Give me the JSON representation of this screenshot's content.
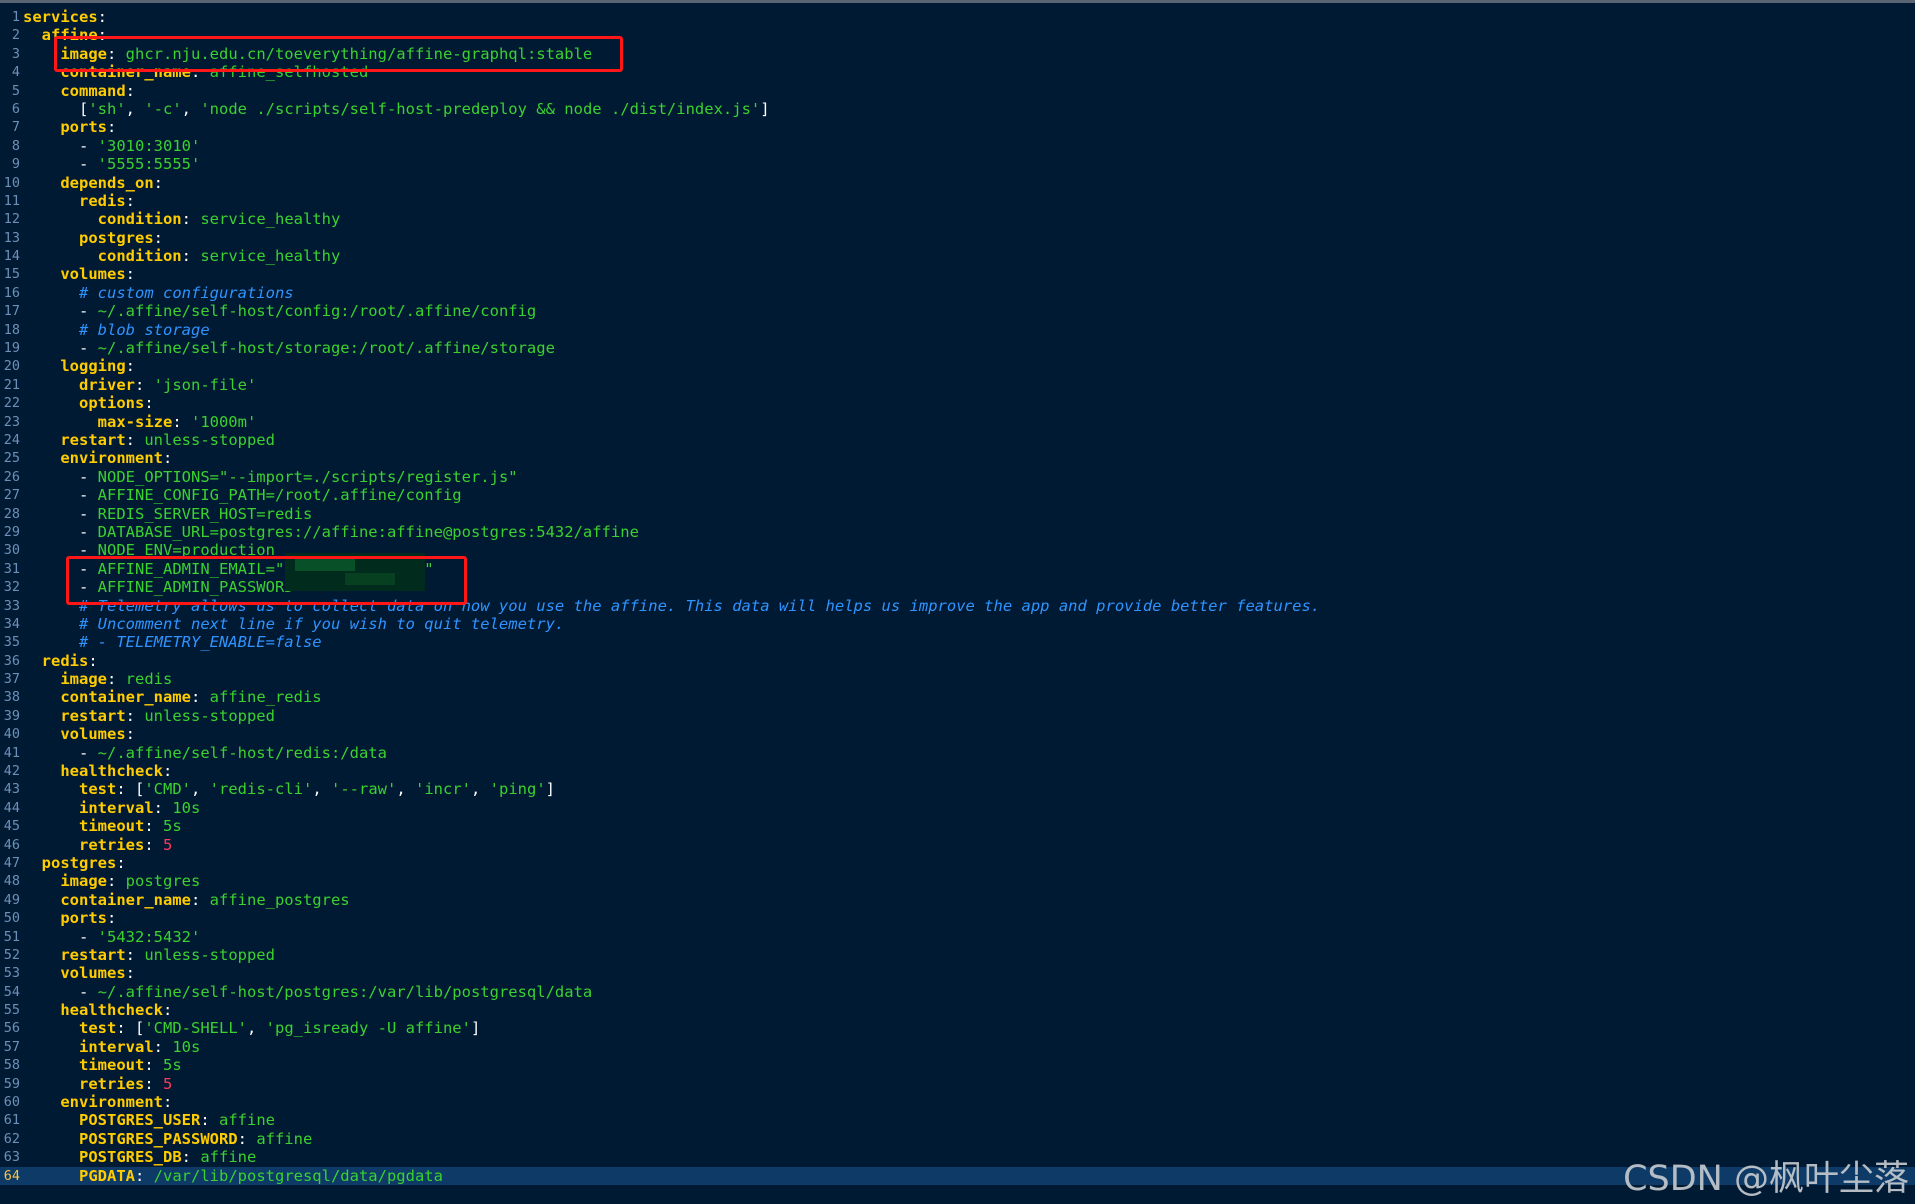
{
  "editor": {
    "language": "yaml",
    "current_line": 64,
    "colors": {
      "background": "#011a33",
      "key": "#ffcc00",
      "string": "#3bd12f",
      "number": "#ff3b5c",
      "comment": "#2f94ff",
      "line_number": "#6d90b8",
      "current_line_bg": "#0d3a66",
      "highlight_box": "#ff1616"
    },
    "lines": [
      [
        {
          "s": "k",
          "t": "services"
        },
        {
          "s": "p",
          "t": ":"
        }
      ],
      [
        {
          "s": "t",
          "t": "  "
        },
        {
          "s": "k",
          "t": "affine"
        },
        {
          "s": "p",
          "t": ":"
        }
      ],
      [
        {
          "s": "t",
          "t": "    "
        },
        {
          "s": "k",
          "t": "image"
        },
        {
          "s": "p",
          "t": ": "
        },
        {
          "s": "v",
          "t": "ghcr.nju.edu.cn/toeverything/affine-graphql:stable"
        }
      ],
      [
        {
          "s": "t",
          "t": "    "
        },
        {
          "s": "k",
          "t": "container_name"
        },
        {
          "s": "p",
          "t": ": "
        },
        {
          "s": "v",
          "t": "affine_selfhosted"
        }
      ],
      [
        {
          "s": "t",
          "t": "    "
        },
        {
          "s": "k",
          "t": "command"
        },
        {
          "s": "p",
          "t": ":"
        }
      ],
      [
        {
          "s": "t",
          "t": "      "
        },
        {
          "s": "p",
          "t": "["
        },
        {
          "s": "v",
          "t": "'sh'"
        },
        {
          "s": "p",
          "t": ", "
        },
        {
          "s": "v",
          "t": "'-c'"
        },
        {
          "s": "p",
          "t": ", "
        },
        {
          "s": "v",
          "t": "'node ./scripts/self-host-predeploy && node ./dist/index.js'"
        },
        {
          "s": "p",
          "t": "]"
        }
      ],
      [
        {
          "s": "t",
          "t": "    "
        },
        {
          "s": "k",
          "t": "ports"
        },
        {
          "s": "p",
          "t": ":"
        }
      ],
      [
        {
          "s": "t",
          "t": "      "
        },
        {
          "s": "p",
          "t": "- "
        },
        {
          "s": "v",
          "t": "'3010:3010'"
        }
      ],
      [
        {
          "s": "t",
          "t": "      "
        },
        {
          "s": "p",
          "t": "- "
        },
        {
          "s": "v",
          "t": "'5555:5555'"
        }
      ],
      [
        {
          "s": "t",
          "t": "    "
        },
        {
          "s": "k",
          "t": "depends_on"
        },
        {
          "s": "p",
          "t": ":"
        }
      ],
      [
        {
          "s": "t",
          "t": "      "
        },
        {
          "s": "k",
          "t": "redis"
        },
        {
          "s": "p",
          "t": ":"
        }
      ],
      [
        {
          "s": "t",
          "t": "        "
        },
        {
          "s": "k",
          "t": "condition"
        },
        {
          "s": "p",
          "t": ": "
        },
        {
          "s": "v",
          "t": "service_healthy"
        }
      ],
      [
        {
          "s": "t",
          "t": "      "
        },
        {
          "s": "k",
          "t": "postgres"
        },
        {
          "s": "p",
          "t": ":"
        }
      ],
      [
        {
          "s": "t",
          "t": "        "
        },
        {
          "s": "k",
          "t": "condition"
        },
        {
          "s": "p",
          "t": ": "
        },
        {
          "s": "v",
          "t": "service_healthy"
        }
      ],
      [
        {
          "s": "t",
          "t": "    "
        },
        {
          "s": "k",
          "t": "volumes"
        },
        {
          "s": "p",
          "t": ":"
        }
      ],
      [
        {
          "s": "t",
          "t": "      "
        },
        {
          "s": "c",
          "t": "# custom configurations"
        }
      ],
      [
        {
          "s": "t",
          "t": "      "
        },
        {
          "s": "p",
          "t": "- "
        },
        {
          "s": "v",
          "t": "~/.affine/self-host/config:/root/.affine/config"
        }
      ],
      [
        {
          "s": "t",
          "t": "      "
        },
        {
          "s": "c",
          "t": "# blob storage"
        }
      ],
      [
        {
          "s": "t",
          "t": "      "
        },
        {
          "s": "p",
          "t": "- "
        },
        {
          "s": "v",
          "t": "~/.affine/self-host/storage:/root/.affine/storage"
        }
      ],
      [
        {
          "s": "t",
          "t": "    "
        },
        {
          "s": "k",
          "t": "logging"
        },
        {
          "s": "p",
          "t": ":"
        }
      ],
      [
        {
          "s": "t",
          "t": "      "
        },
        {
          "s": "k",
          "t": "driver"
        },
        {
          "s": "p",
          "t": ": "
        },
        {
          "s": "v",
          "t": "'json-file'"
        }
      ],
      [
        {
          "s": "t",
          "t": "      "
        },
        {
          "s": "k",
          "t": "options"
        },
        {
          "s": "p",
          "t": ":"
        }
      ],
      [
        {
          "s": "t",
          "t": "        "
        },
        {
          "s": "k",
          "t": "max-size"
        },
        {
          "s": "p",
          "t": ": "
        },
        {
          "s": "v",
          "t": "'1000m'"
        }
      ],
      [
        {
          "s": "t",
          "t": "    "
        },
        {
          "s": "k",
          "t": "restart"
        },
        {
          "s": "p",
          "t": ": "
        },
        {
          "s": "v",
          "t": "unless-stopped"
        }
      ],
      [
        {
          "s": "t",
          "t": "    "
        },
        {
          "s": "k",
          "t": "environment"
        },
        {
          "s": "p",
          "t": ":"
        }
      ],
      [
        {
          "s": "t",
          "t": "      "
        },
        {
          "s": "p",
          "t": "- "
        },
        {
          "s": "v",
          "t": "NODE_OPTIONS=\"--import=./scripts/register.js\""
        }
      ],
      [
        {
          "s": "t",
          "t": "      "
        },
        {
          "s": "p",
          "t": "- "
        },
        {
          "s": "v",
          "t": "AFFINE_CONFIG_PATH=/root/.affine/config"
        }
      ],
      [
        {
          "s": "t",
          "t": "      "
        },
        {
          "s": "p",
          "t": "- "
        },
        {
          "s": "v",
          "t": "REDIS_SERVER_HOST=redis"
        }
      ],
      [
        {
          "s": "t",
          "t": "      "
        },
        {
          "s": "p",
          "t": "- "
        },
        {
          "s": "v",
          "t": "DATABASE_URL=postgres://affine:affine@postgres:5432/affine"
        }
      ],
      [
        {
          "s": "t",
          "t": "      "
        },
        {
          "s": "p",
          "t": "- "
        },
        {
          "s": "v",
          "t": "NODE_ENV=production"
        }
      ],
      [
        {
          "s": "t",
          "t": "      "
        },
        {
          "s": "p",
          "t": "- "
        },
        {
          "s": "v",
          "t": "AFFINE_ADMIN_EMAIL=\""
        },
        {
          "s": "v",
          "t": "               \""
        }
      ],
      [
        {
          "s": "t",
          "t": "      "
        },
        {
          "s": "p",
          "t": "- "
        },
        {
          "s": "v",
          "t": "AFFINE_ADMIN_PASSWORD=\""
        }
      ],
      [
        {
          "s": "t",
          "t": "      "
        },
        {
          "s": "c",
          "t": "# Telemetry allows us to collect data on how you use the affine. This data will helps us improve the app and provide better features."
        }
      ],
      [
        {
          "s": "t",
          "t": "      "
        },
        {
          "s": "c",
          "t": "# Uncomment next line if you wish to quit telemetry."
        }
      ],
      [
        {
          "s": "t",
          "t": "      "
        },
        {
          "s": "c",
          "t": "# - TELEMETRY_ENABLE=false"
        }
      ],
      [
        {
          "s": "t",
          "t": "  "
        },
        {
          "s": "k",
          "t": "redis"
        },
        {
          "s": "p",
          "t": ":"
        }
      ],
      [
        {
          "s": "t",
          "t": "    "
        },
        {
          "s": "k",
          "t": "image"
        },
        {
          "s": "p",
          "t": ": "
        },
        {
          "s": "v",
          "t": "redis"
        }
      ],
      [
        {
          "s": "t",
          "t": "    "
        },
        {
          "s": "k",
          "t": "container_name"
        },
        {
          "s": "p",
          "t": ": "
        },
        {
          "s": "v",
          "t": "affine_redis"
        }
      ],
      [
        {
          "s": "t",
          "t": "    "
        },
        {
          "s": "k",
          "t": "restart"
        },
        {
          "s": "p",
          "t": ": "
        },
        {
          "s": "v",
          "t": "unless-stopped"
        }
      ],
      [
        {
          "s": "t",
          "t": "    "
        },
        {
          "s": "k",
          "t": "volumes"
        },
        {
          "s": "p",
          "t": ":"
        }
      ],
      [
        {
          "s": "t",
          "t": "      "
        },
        {
          "s": "p",
          "t": "- "
        },
        {
          "s": "v",
          "t": "~/.affine/self-host/redis:/data"
        }
      ],
      [
        {
          "s": "t",
          "t": "    "
        },
        {
          "s": "k",
          "t": "healthcheck"
        },
        {
          "s": "p",
          "t": ":"
        }
      ],
      [
        {
          "s": "t",
          "t": "      "
        },
        {
          "s": "k",
          "t": "test"
        },
        {
          "s": "p",
          "t": ": ["
        },
        {
          "s": "v",
          "t": "'CMD'"
        },
        {
          "s": "p",
          "t": ", "
        },
        {
          "s": "v",
          "t": "'redis-cli'"
        },
        {
          "s": "p",
          "t": ", "
        },
        {
          "s": "v",
          "t": "'--raw'"
        },
        {
          "s": "p",
          "t": ", "
        },
        {
          "s": "v",
          "t": "'incr'"
        },
        {
          "s": "p",
          "t": ", "
        },
        {
          "s": "v",
          "t": "'ping'"
        },
        {
          "s": "p",
          "t": "]"
        }
      ],
      [
        {
          "s": "t",
          "t": "      "
        },
        {
          "s": "k",
          "t": "interval"
        },
        {
          "s": "p",
          "t": ": "
        },
        {
          "s": "v",
          "t": "10s"
        }
      ],
      [
        {
          "s": "t",
          "t": "      "
        },
        {
          "s": "k",
          "t": "timeout"
        },
        {
          "s": "p",
          "t": ": "
        },
        {
          "s": "v",
          "t": "5s"
        }
      ],
      [
        {
          "s": "t",
          "t": "      "
        },
        {
          "s": "k",
          "t": "retries"
        },
        {
          "s": "p",
          "t": ": "
        },
        {
          "s": "n",
          "t": "5"
        }
      ],
      [
        {
          "s": "t",
          "t": "  "
        },
        {
          "s": "k",
          "t": "postgres"
        },
        {
          "s": "p",
          "t": ":"
        }
      ],
      [
        {
          "s": "t",
          "t": "    "
        },
        {
          "s": "k",
          "t": "image"
        },
        {
          "s": "p",
          "t": ": "
        },
        {
          "s": "v",
          "t": "postgres"
        }
      ],
      [
        {
          "s": "t",
          "t": "    "
        },
        {
          "s": "k",
          "t": "container_name"
        },
        {
          "s": "p",
          "t": ": "
        },
        {
          "s": "v",
          "t": "affine_postgres"
        }
      ],
      [
        {
          "s": "t",
          "t": "    "
        },
        {
          "s": "k",
          "t": "ports"
        },
        {
          "s": "p",
          "t": ":"
        }
      ],
      [
        {
          "s": "t",
          "t": "      "
        },
        {
          "s": "p",
          "t": "- "
        },
        {
          "s": "v",
          "t": "'5432:5432'"
        }
      ],
      [
        {
          "s": "t",
          "t": "    "
        },
        {
          "s": "k",
          "t": "restart"
        },
        {
          "s": "p",
          "t": ": "
        },
        {
          "s": "v",
          "t": "unless-stopped"
        }
      ],
      [
        {
          "s": "t",
          "t": "    "
        },
        {
          "s": "k",
          "t": "volumes"
        },
        {
          "s": "p",
          "t": ":"
        }
      ],
      [
        {
          "s": "t",
          "t": "      "
        },
        {
          "s": "p",
          "t": "- "
        },
        {
          "s": "v",
          "t": "~/.affine/self-host/postgres:/var/lib/postgresql/data"
        }
      ],
      [
        {
          "s": "t",
          "t": "    "
        },
        {
          "s": "k",
          "t": "healthcheck"
        },
        {
          "s": "p",
          "t": ":"
        }
      ],
      [
        {
          "s": "t",
          "t": "      "
        },
        {
          "s": "k",
          "t": "test"
        },
        {
          "s": "p",
          "t": ": ["
        },
        {
          "s": "v",
          "t": "'CMD-SHELL'"
        },
        {
          "s": "p",
          "t": ", "
        },
        {
          "s": "v",
          "t": "'pg_isready -U affine'"
        },
        {
          "s": "p",
          "t": "]"
        }
      ],
      [
        {
          "s": "t",
          "t": "      "
        },
        {
          "s": "k",
          "t": "interval"
        },
        {
          "s": "p",
          "t": ": "
        },
        {
          "s": "v",
          "t": "10s"
        }
      ],
      [
        {
          "s": "t",
          "t": "      "
        },
        {
          "s": "k",
          "t": "timeout"
        },
        {
          "s": "p",
          "t": ": "
        },
        {
          "s": "v",
          "t": "5s"
        }
      ],
      [
        {
          "s": "t",
          "t": "      "
        },
        {
          "s": "k",
          "t": "retries"
        },
        {
          "s": "p",
          "t": ": "
        },
        {
          "s": "n",
          "t": "5"
        }
      ],
      [
        {
          "s": "t",
          "t": "    "
        },
        {
          "s": "k",
          "t": "environment"
        },
        {
          "s": "p",
          "t": ":"
        }
      ],
      [
        {
          "s": "t",
          "t": "      "
        },
        {
          "s": "k",
          "t": "POSTGRES_USER"
        },
        {
          "s": "p",
          "t": ": "
        },
        {
          "s": "v",
          "t": "affine"
        }
      ],
      [
        {
          "s": "t",
          "t": "      "
        },
        {
          "s": "k",
          "t": "POSTGRES_PASSWORD"
        },
        {
          "s": "p",
          "t": ": "
        },
        {
          "s": "v",
          "t": "affine"
        }
      ],
      [
        {
          "s": "t",
          "t": "      "
        },
        {
          "s": "k",
          "t": "POSTGRES_DB"
        },
        {
          "s": "p",
          "t": ": "
        },
        {
          "s": "v",
          "t": "affine"
        }
      ],
      [
        {
          "s": "t",
          "t": "      "
        },
        {
          "s": "k",
          "t": "PGDATA"
        },
        {
          "s": "p",
          "t": ": "
        },
        {
          "s": "v",
          "t": "/var/lib/postgresql/data/pgdata"
        }
      ]
    ],
    "highlighted_lines": [
      [
        3
      ],
      [
        31,
        32
      ]
    ]
  },
  "watermark": {
    "text": "CSDN @枫叶尘落"
  }
}
